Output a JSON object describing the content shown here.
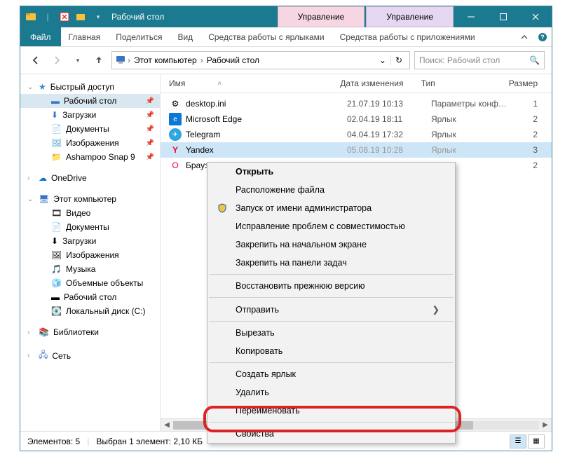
{
  "titlebar": {
    "title": "Рабочий стол"
  },
  "context_tabs": [
    {
      "label": "Управление"
    },
    {
      "label": "Управление"
    }
  ],
  "ribbon": {
    "file": "Файл",
    "tabs": [
      "Главная",
      "Поделиться",
      "Вид",
      "Средства работы с ярлыками",
      "Средства работы с приложениями"
    ]
  },
  "breadcrumb": {
    "parts": [
      "Этот компьютер",
      "Рабочий стол"
    ]
  },
  "search": {
    "placeholder": "Поиск: Рабочий стол"
  },
  "sidebar": {
    "quick_access": "Быстрый доступ",
    "quick_items": [
      {
        "label": "Рабочий стол",
        "selected": true,
        "pinned": true
      },
      {
        "label": "Загрузки",
        "pinned": true
      },
      {
        "label": "Документы",
        "pinned": true
      },
      {
        "label": "Изображения",
        "pinned": true
      },
      {
        "label": "Ashampoo Snap 9",
        "pinned": true
      }
    ],
    "onedrive": "OneDrive",
    "this_pc": "Этот компьютер",
    "pc_items": [
      "Видео",
      "Документы",
      "Загрузки",
      "Изображения",
      "Музыка",
      "Объемные объекты",
      "Рабочий стол",
      "Локальный диск (C:)"
    ],
    "libraries": "Библиотеки",
    "network": "Сеть"
  },
  "columns": {
    "name": "Имя",
    "date": "Дата изменения",
    "type": "Тип",
    "size": "Размер"
  },
  "rows": [
    {
      "name": "desktop.ini",
      "date": "21.07.19 10:13",
      "type": "Параметры конф…",
      "size": "1"
    },
    {
      "name": "Microsoft Edge",
      "date": "02.04.19 18:11",
      "type": "Ярлык",
      "size": "2"
    },
    {
      "name": "Telegram",
      "date": "04.04.19 17:32",
      "type": "Ярлык",
      "size": "2"
    },
    {
      "name": "Yandex",
      "date": "05.08.19 10:28",
      "type": "Ярлык",
      "size": "3",
      "selected": true
    },
    {
      "name": "Браузер",
      "date": "",
      "type": "",
      "size": "2"
    }
  ],
  "status": {
    "count": "Элементов: 5",
    "selection": "Выбран 1 элемент: 2,10 КБ"
  },
  "context_menu": {
    "open": "Открыть",
    "file_location": "Расположение файла",
    "run_admin": "Запуск от имени администратора",
    "compat": "Исправление проблем с совместимостью",
    "pin_start": "Закрепить на начальном экране",
    "pin_taskbar": "Закрепить на панели задач",
    "restore": "Восстановить прежнюю версию",
    "send_to": "Отправить",
    "cut": "Вырезать",
    "copy": "Копировать",
    "create_shortcut": "Создать ярлык",
    "delete": "Удалить",
    "rename": "Переименовать",
    "properties": "Свойства"
  }
}
